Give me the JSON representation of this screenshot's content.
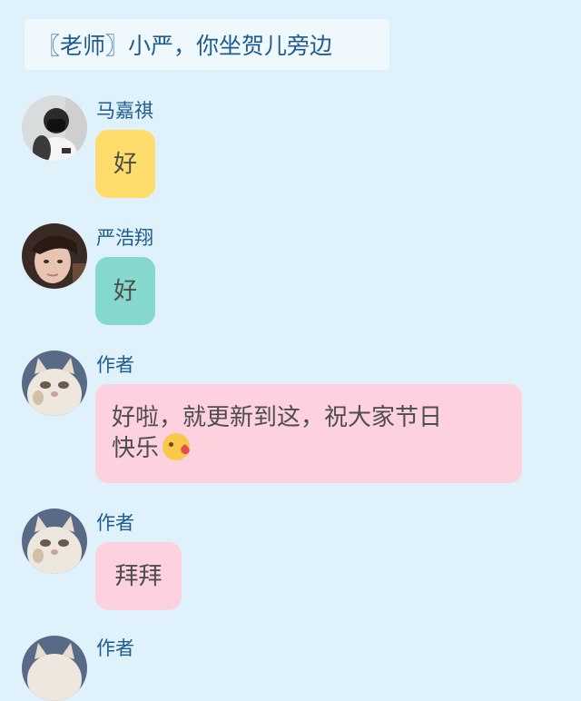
{
  "narration": "〖老师〗小严，你坐贺儿旁边",
  "messages": [
    {
      "name": "马嘉祺",
      "text": "好",
      "bubble_color": "#fedd6d",
      "avatar": "boy-with-mask-avatar"
    },
    {
      "name": "严浩翔",
      "text": "好",
      "bubble_color": "#85d8cc",
      "avatar": "boy-portrait-avatar"
    },
    {
      "name": "作者",
      "text_line1": "好啦，就更新到这，祝大家节日",
      "text_line2": "快乐",
      "emoji": "kissing-face-emoji",
      "bubble_color": "#fdd1dd",
      "avatar": "white-cat-avatar"
    },
    {
      "name": "作者",
      "text": "拜拜",
      "bubble_color": "#fdd1dd",
      "avatar": "white-cat-avatar"
    },
    {
      "name": "作者",
      "avatar": "white-cat-avatar"
    }
  ],
  "colors": {
    "background": "#dff2fc",
    "name_text": "#1f5b8f",
    "bubble_text": "#4d4d4d"
  }
}
